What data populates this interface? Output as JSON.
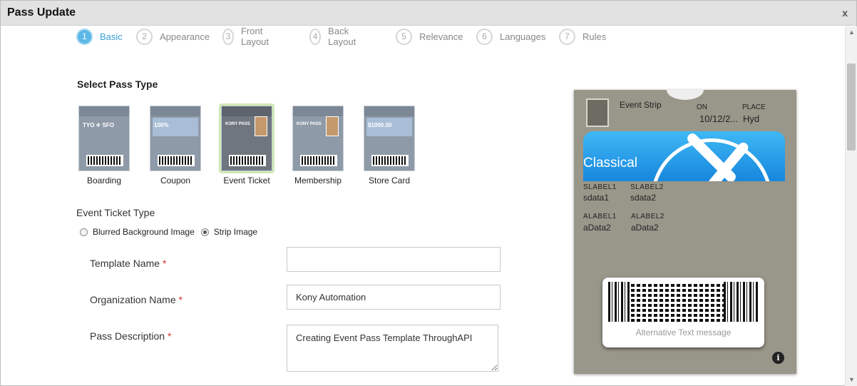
{
  "dialog": {
    "title": "Pass Update",
    "close": "x"
  },
  "steps": [
    {
      "num": "1",
      "label": "Basic",
      "active": true
    },
    {
      "num": "2",
      "label": "Appearance"
    },
    {
      "num": "3",
      "label": "Front Layout"
    },
    {
      "num": "4",
      "label": "Back Layout"
    },
    {
      "num": "5",
      "label": "Relevance"
    },
    {
      "num": "6",
      "label": "Languages"
    },
    {
      "num": "7",
      "label": "Rules"
    }
  ],
  "pass_type": {
    "title": "Select Pass Type",
    "selected": "Event Ticket",
    "types": [
      {
        "label": "Boarding",
        "thumb": "TYO ✈ SFO"
      },
      {
        "label": "Coupon",
        "thumb": "100%"
      },
      {
        "label": "Event Ticket",
        "thumb": "KONY PASS"
      },
      {
        "label": "Membership",
        "thumb": "KONY PASS"
      },
      {
        "label": "Store Card",
        "thumb": "$1000.00"
      }
    ]
  },
  "event_ticket_type": {
    "title": "Event Ticket Type",
    "options": [
      {
        "label": "Blurred Background Image",
        "selected": false
      },
      {
        "label": "Strip Image",
        "selected": true
      }
    ]
  },
  "form": {
    "template_name": {
      "label": "Template Name",
      "required": "*",
      "value": ""
    },
    "organization_name": {
      "label": "Organization Name",
      "required": "*",
      "value": "Kony Automation"
    },
    "pass_description": {
      "label": "Pass Description",
      "required": "*",
      "value": "Creating Event Pass Template ThroughAPI"
    }
  },
  "preview": {
    "logo_text": "Event Strip",
    "header": [
      {
        "label": "ON",
        "value": "10/12/2..."
      },
      {
        "label": "PLACE",
        "value": "Hyd"
      }
    ],
    "strip_title": "Classical",
    "secondary": [
      {
        "label": "SLABEL1",
        "value": "sdata1"
      },
      {
        "label": "SLABEL2",
        "value": "sdata2"
      }
    ],
    "auxiliary": [
      {
        "label": "ALABEL1",
        "value": "aData2"
      },
      {
        "label": "ALABEL2",
        "value": "aData2"
      }
    ],
    "barcode_alt_text": "Alternative Text message",
    "info": "i",
    "background_color": "#99968a"
  },
  "scrollbar": {
    "up": "▲",
    "down": "▼"
  },
  "colors": {
    "accent": "#5cb8e6",
    "required": "#d9312b"
  }
}
